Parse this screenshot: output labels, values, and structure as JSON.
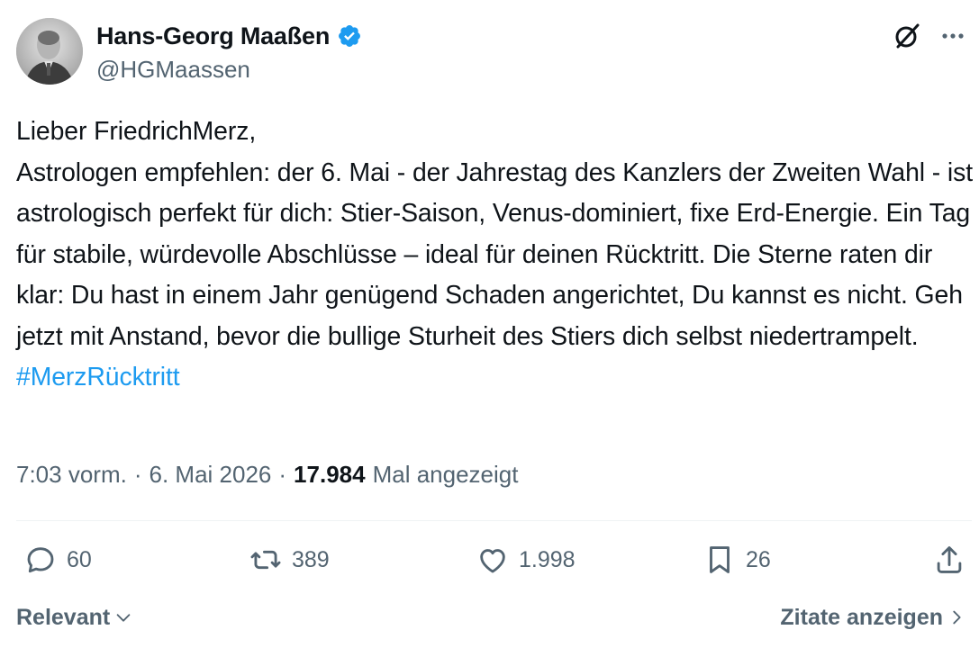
{
  "author": {
    "display_name": "Hans-Georg Maaßen",
    "handle": "@HGMaassen",
    "verified_icon": "verified-badge-icon",
    "verified_color": "#1d9bf0"
  },
  "header_icons": {
    "grok": "grok-icon",
    "more": "more-icon"
  },
  "tweet": {
    "text": "Lieber FriedrichMerz,\nAstrologen empfehlen: der 6. Mai - der Jahrestag des Kanzlers der Zweiten Wahl -  ist astrologisch perfekt für dich: Stier-Saison, Venus-dominiert, fixe Erd-Energie. Ein Tag für stabile, würdevolle Abschlüsse – ideal für deinen Rücktritt. Die Sterne raten dir klar: Du hast in einem Jahr genügend Schaden angerichtet, Du kannst es nicht. Geh jetzt mit Anstand, bevor die bullige Sturheit des Stiers dich selbst niedertrampelt.",
    "hashtag": "#MerzRücktritt",
    "hashtag_color": "#1d9bf0"
  },
  "meta": {
    "time": "7:03 vorm.",
    "separator": "·",
    "date": "6. Mai 2026",
    "views_count": "17.984",
    "views_label": "Mal angezeigt"
  },
  "actions": {
    "replies": "60",
    "reposts": "389",
    "likes": "1.998",
    "bookmarks": "26"
  },
  "footer": {
    "sort_label": "Relevant",
    "quotes_label": "Zitate anzeigen"
  },
  "colors": {
    "text": "#0f1419",
    "secondary": "#536471",
    "accent": "#1d9bf0",
    "divider": "#eff3f4"
  }
}
